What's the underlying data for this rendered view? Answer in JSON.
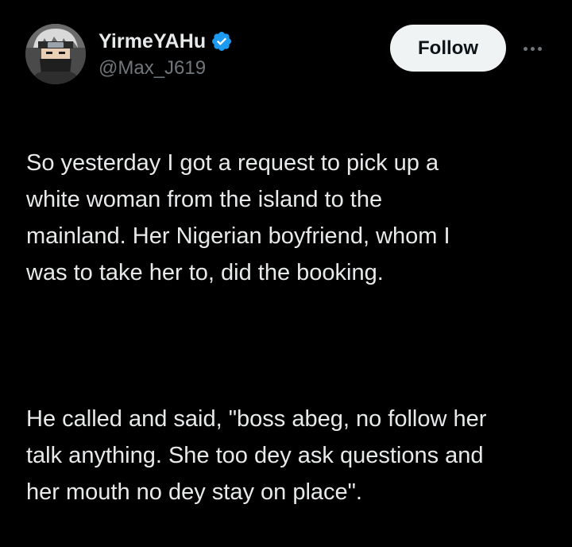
{
  "tweet": {
    "author": {
      "display_name": "YirmeYAHu",
      "handle": "@Max_J619",
      "verified": true,
      "avatar_icon": "masked-ninja-avatar"
    },
    "follow_label": "Follow",
    "more_icon": "more-horizontal-icon",
    "paragraphs": [
      "So yesterday I got a request to pick up a\nwhite woman from the island to the\nmainland. Her Nigerian boyfriend, whom I\nwas to take her to, did the booking.",
      "He called and said, \"boss abeg, no follow her\ntalk anything. She too dey ask questions and\nher mouth no dey stay on place\"."
    ]
  },
  "colors": {
    "background": "#000000",
    "text_primary": "#e7e9ea",
    "text_secondary": "#71767b",
    "verified_blue": "#1d9bf0",
    "follow_bg": "#eff3f4",
    "follow_text": "#0f1419"
  }
}
